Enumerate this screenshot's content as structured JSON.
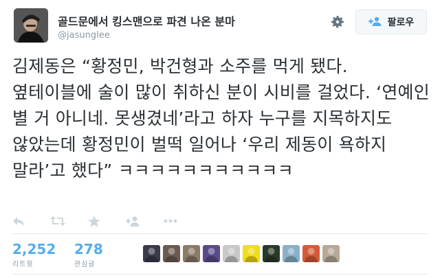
{
  "user": {
    "display_name": "골드문에서 킹스맨으로 파견 나온 분마",
    "handle": "@jasunglee"
  },
  "follow_button": {
    "label": "팔로우"
  },
  "tweet": {
    "text": "김제동은 “황정민, 박건형과 소주를 먹게 됐다. 옆테이블에 술이 많이 취하신 분이 시비를 걸었다. ‘연예인 별 거 아니네. 못생겼네’라고 하자 누구를 지목하지도 않았는데 황정민이 벌떡 일어나 ‘우리 제동이 욕하지 말라’고 했다” ㅋㅋㅋㅋㅋㅋㅋㅋㅋㅋㅋ"
  },
  "actions": [
    "reply-icon",
    "retweet-icon",
    "favorite-icon",
    "follow-icon",
    "more-icon"
  ],
  "stats": {
    "retweets": {
      "value": "2,252",
      "label": "리트윗"
    },
    "favorites": {
      "value": "278",
      "label": "관심글"
    }
  },
  "likers": [
    {
      "name": "liker-avatar-1",
      "color": "#3a3a4a"
    },
    {
      "name": "liker-avatar-2",
      "color": "#6a5a50"
    },
    {
      "name": "liker-avatar-3",
      "color": "#8a7a68"
    },
    {
      "name": "liker-avatar-4",
      "color": "#5a4a8a"
    },
    {
      "name": "liker-avatar-5",
      "color": "#c8c8c8"
    },
    {
      "name": "liker-avatar-6",
      "color": "#f2dc1e"
    },
    {
      "name": "liker-avatar-7",
      "color": "#2a3a2a"
    },
    {
      "name": "liker-avatar-8",
      "color": "#8ab0c8"
    },
    {
      "name": "liker-avatar-9",
      "color": "#d45a3a"
    },
    {
      "name": "liker-avatar-10",
      "color": "#b8a898"
    }
  ],
  "colors": {
    "accent": "#55acee",
    "text": "#292f33",
    "muted": "#8899a6",
    "border": "#e1e8ed"
  }
}
